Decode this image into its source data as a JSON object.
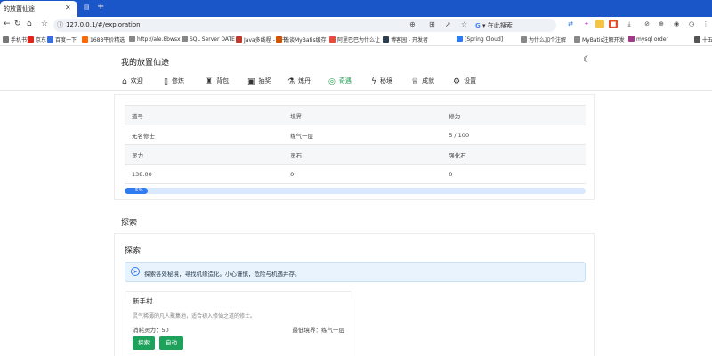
{
  "browser": {
    "tab_title": "的放置仙途",
    "url": "127.0.0.1/#/exploration",
    "search_engine_label": "在此搜索",
    "bookmarks": [
      {
        "label": "手机书签",
        "color": "#777777"
      },
      {
        "label": "京东",
        "color": "#e1251b"
      },
      {
        "label": "百度一下",
        "color": "#3a6fe0"
      },
      {
        "label": "1688平价精选",
        "color": "#ff6a00"
      },
      {
        "label": "http://ale.8bwsx",
        "color": "#888888"
      },
      {
        "label": "SQL Server DATE",
        "color": "#888888"
      },
      {
        "label": "Java多线程 - 看书",
        "color": "#c0392b"
      },
      {
        "label": "浅谈MyBatis缓存",
        "color": "#d35400"
      },
      {
        "label": "阿里巴巴为什么让",
        "color": "#e74c3c"
      },
      {
        "label": "博客园 - 开发者",
        "color": "#2c3e50"
      },
      {
        "label": "[Spring Cloud]",
        "color": "#2f7bf0"
      },
      {
        "label": "为什么加个注解",
        "color": "#888888"
      },
      {
        "label": "MyBatis注解开发",
        "color": "#888888"
      },
      {
        "label": "mysql order",
        "color": "#a03a8a"
      },
      {
        "label": "十五",
        "color": "#555555"
      }
    ]
  },
  "app": {
    "title": "我的放置仙途",
    "nav": [
      {
        "label": "欢迎",
        "icon": "home-icon",
        "glyph": "⌂",
        "active": false
      },
      {
        "label": "修炼",
        "icon": "book-icon",
        "glyph": "▯",
        "active": false
      },
      {
        "label": "背包",
        "icon": "bag-icon",
        "glyph": "♜",
        "active": false
      },
      {
        "label": "抽奖",
        "icon": "gift-icon",
        "glyph": "▣",
        "active": false
      },
      {
        "label": "炼丹",
        "icon": "flask-icon",
        "glyph": "⚗",
        "active": false
      },
      {
        "label": "奇遇",
        "icon": "compass-icon",
        "glyph": "◎",
        "active": true
      },
      {
        "label": "秘境",
        "icon": "lightning-icon",
        "glyph": "ϟ",
        "active": false
      },
      {
        "label": "成就",
        "icon": "trophy-icon",
        "glyph": "♕",
        "active": false
      },
      {
        "label": "设置",
        "icon": "gear-icon",
        "glyph": "⚙",
        "active": false
      }
    ]
  },
  "stats": {
    "headers_1": [
      "道号",
      "境界",
      "修为"
    ],
    "values_1": [
      "无名修士",
      "练气一层",
      "5 / 100"
    ],
    "headers_2": [
      "灵力",
      "灵石",
      "强化石"
    ],
    "values_2": [
      "138.00",
      "0",
      "0"
    ],
    "progress_percent": 5,
    "progress_label": "5%"
  },
  "exploration": {
    "section_title": "探索",
    "card_title": "探索",
    "info_text": "探索各处秘境，寻找机缘造化。小心谨慎，危险与机遇并存。",
    "area": {
      "name": "新手村",
      "description": "灵气稀薄的凡人聚集地，适合初入修仙之道的修士。",
      "cost": "消耗灵力：50",
      "requirement": "最低境界：练气一层",
      "explore_label": "探索",
      "auto_label": "自动"
    }
  },
  "colors": {
    "accent": "#1a9a4a",
    "progress": "#2f7bf0",
    "button": "#1ea15a",
    "tabbar": "#1a56c8"
  }
}
